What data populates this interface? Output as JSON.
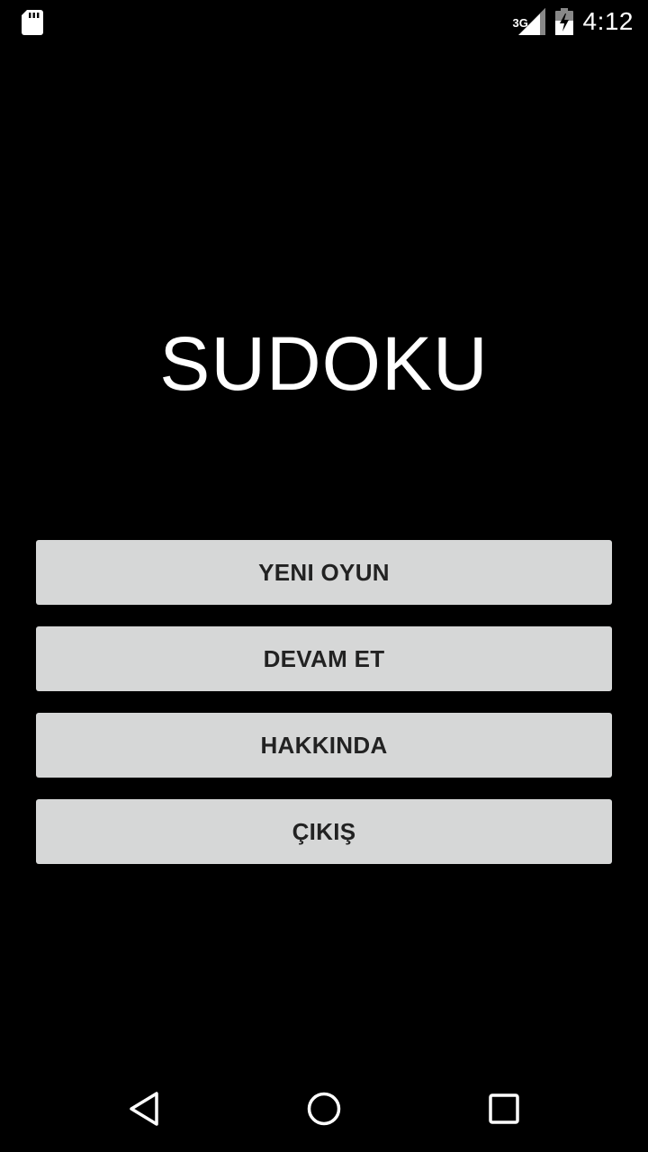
{
  "status_bar": {
    "network_type": "3G",
    "time": "4:12",
    "icons": [
      "sd-card-icon",
      "signal-icon",
      "battery-charging-icon"
    ]
  },
  "app": {
    "title": "SUDOKU"
  },
  "menu": {
    "buttons": [
      {
        "label": "YENI OYUN"
      },
      {
        "label": "DEVAM ET"
      },
      {
        "label": "HAKKINDA"
      },
      {
        "label": "ÇIKIŞ"
      }
    ]
  },
  "nav_bar": {
    "icons": [
      "back-icon",
      "home-icon",
      "recents-icon"
    ]
  },
  "colors": {
    "background": "#000000",
    "button_bg": "#d6d7d7",
    "button_text": "#222222",
    "title_text": "#ffffff"
  }
}
